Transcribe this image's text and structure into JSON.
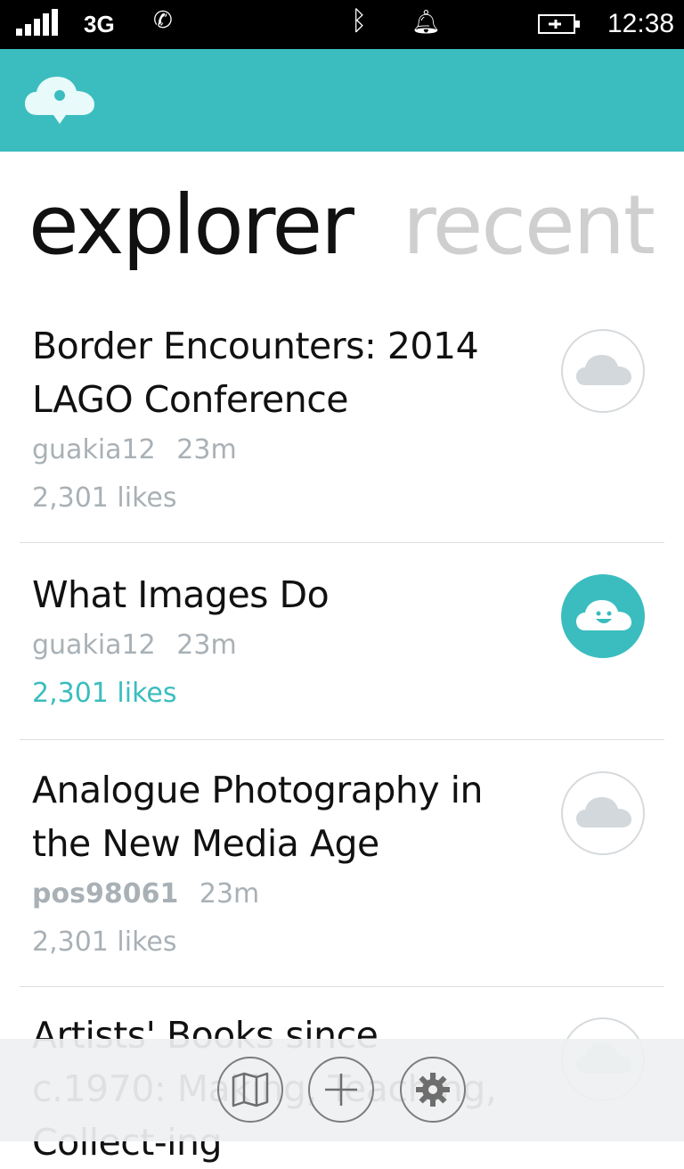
{
  "status_bar": {
    "network": "3G",
    "time": "12:38",
    "icons": [
      "signal-icon",
      "call-forward-icon",
      "bluetooth-icon",
      "ringer-icon",
      "battery-charging-icon"
    ]
  },
  "app_bar": {
    "logo": "cloud-pin-logo",
    "color": "#3bbdbf"
  },
  "pivot": {
    "active": "explorer",
    "next": "recent"
  },
  "items": [
    {
      "title": "Border Encounters: 2014 LAGO Conference",
      "user": "guakia12",
      "time": "23m",
      "likes": "2,301 likes",
      "liked": false
    },
    {
      "title": "What Images Do",
      "user": "guakia12",
      "time": "23m",
      "likes": "2,301 likes",
      "liked": true
    },
    {
      "title": "Analogue Photography in the New Media Age",
      "user": "pos98061",
      "time": "23m",
      "likes": "2,301 likes",
      "liked": false
    },
    {
      "title": "Artists' Books since c.1970: Making, Teaching, Collect-ing",
      "liked": false
    }
  ],
  "bottom_bar": {
    "buttons": [
      "map-icon",
      "add-icon",
      "settings-icon"
    ]
  }
}
